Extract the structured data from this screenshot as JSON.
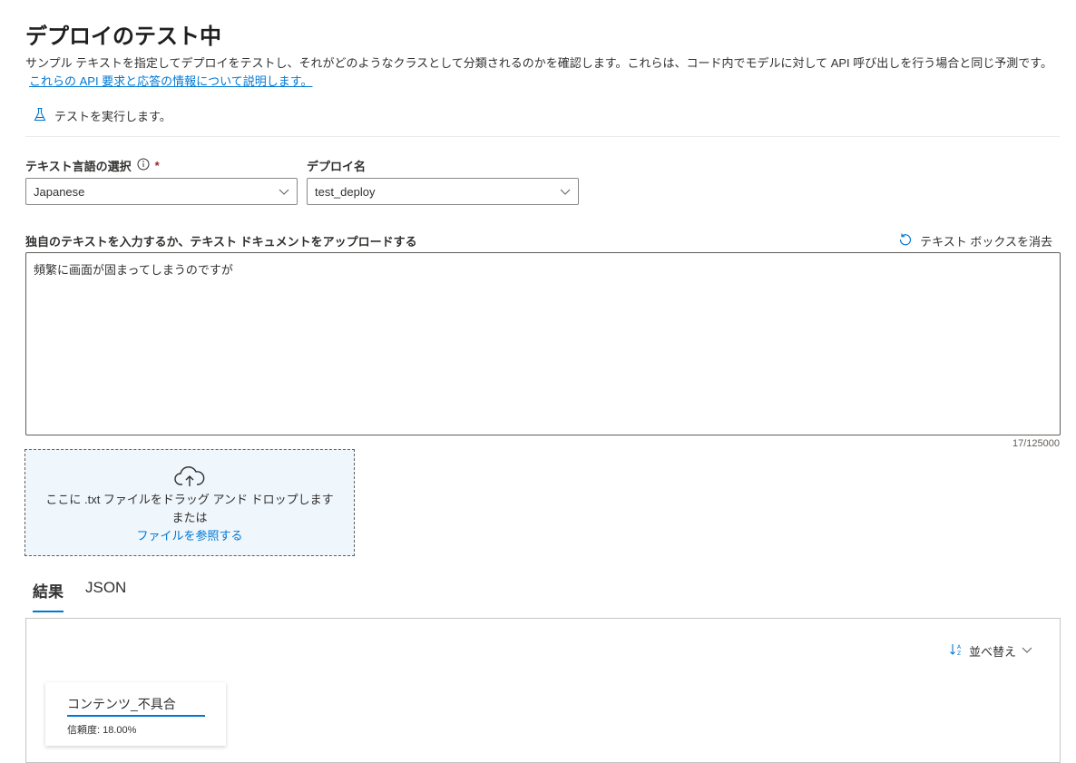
{
  "header": {
    "title": "デプロイのテスト中",
    "description": "サンプル テキストを指定してデプロイをテストし、それがどのようなクラスとして分類されるのかを確認します。これらは、コード内でモデルに対して API 呼び出しを行う場合と同じ予測です。",
    "link_text": "これらの API 要求と応答の情報について説明します。"
  },
  "run_test": {
    "label": "テストを実行します。",
    "icon": "flask-icon"
  },
  "language": {
    "label": "テキスト言語の選択",
    "required_mark": "*",
    "value": "Japanese"
  },
  "deployment": {
    "label": "デプロイ名",
    "value": "test_deploy"
  },
  "input": {
    "label": "独自のテキストを入力するか、テキスト ドキュメントをアップロードする",
    "clear_label": "テキスト ボックスを消去",
    "value": "頻繁に画面が固まってしまうのですが",
    "char_count": "17/125000"
  },
  "upload": {
    "line1": "ここに .txt ファイルをドラッグ アンド ドロップします",
    "line2": "または",
    "browse": "ファイルを参照する"
  },
  "tabs": [
    {
      "label": "結果",
      "active": true
    },
    {
      "label": "JSON",
      "active": false
    }
  ],
  "results": {
    "sort_label": "並べ替え",
    "cards": [
      {
        "class_name": "コンテンツ_不具合",
        "confidence": "信頼度: 18.00%"
      }
    ]
  },
  "colors": {
    "accent": "#0078d4",
    "required": "#a4262c",
    "drop_bg": "#eff6fc"
  }
}
